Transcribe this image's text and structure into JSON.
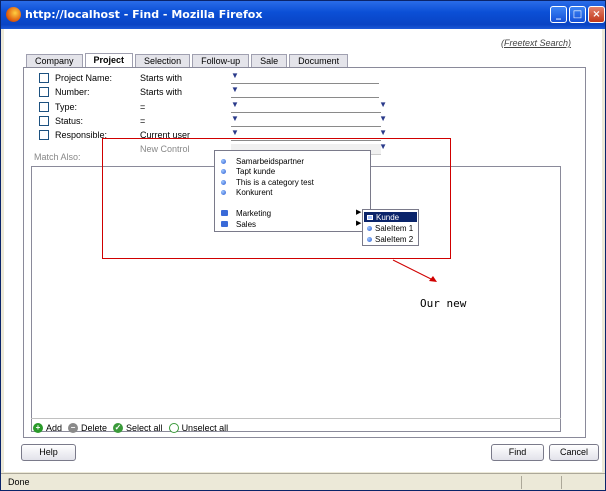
{
  "window": {
    "title": "http://localhost - Find - Mozilla Firefox",
    "minimize": "_",
    "maximize": "□",
    "close": "×"
  },
  "freetext_search": "(Freetext Search)",
  "tabs": [
    {
      "label": "Company",
      "active": false
    },
    {
      "label": "Project",
      "active": true
    },
    {
      "label": "Selection",
      "active": false
    },
    {
      "label": "Follow-up",
      "active": false
    },
    {
      "label": "Sale",
      "active": false
    },
    {
      "label": "Document",
      "active": false
    }
  ],
  "criteria": [
    {
      "label": "Project Name:",
      "operator": "Starts with"
    },
    {
      "label": "Number:",
      "operator": "Starts with"
    },
    {
      "label": "Type:",
      "operator": "="
    },
    {
      "label": "Status:",
      "operator": "="
    },
    {
      "label": "Responsible:",
      "operator": "Current user"
    }
  ],
  "new_control_label": "New Control",
  "match_also": "Match Also:",
  "list_footer": {
    "add": "Add",
    "delete": "Delete",
    "select_all": "Select all",
    "unselect_all": "Unselect all"
  },
  "dropdown": {
    "items": [
      "Samarbeidspartner",
      "Tapt kunde",
      "This is a category test",
      "Konkurent"
    ],
    "groups": [
      "Marketing",
      "Sales"
    ]
  },
  "submenu": {
    "items": [
      "Kunde",
      "SaleItem 1",
      "SaleItem 2"
    ],
    "highlighted": "Kunde"
  },
  "annotation": "Our new",
  "buttons": {
    "help": "Help",
    "find": "Find",
    "cancel": "Cancel"
  },
  "status": "Done",
  "colors": {
    "titlebar": "#0b4fd6",
    "annotation_red": "#d00000",
    "highlight": "#0a246a"
  }
}
